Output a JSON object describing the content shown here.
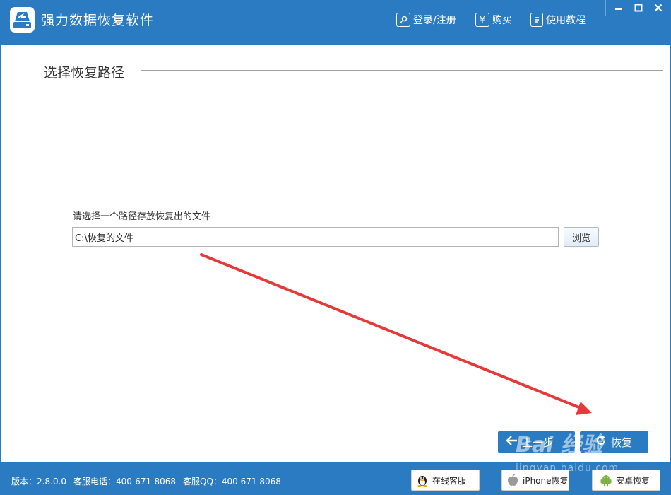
{
  "app": {
    "title": "强力数据恢复软件",
    "icon": "drive-icon"
  },
  "nav": {
    "login_label": "登录/注册",
    "buy_label": "购买",
    "buy_symbol": "¥",
    "tutorial_label": "使用教程"
  },
  "window_controls": [
    "minimize-icon",
    "maximize-icon",
    "close-icon"
  ],
  "section": {
    "title": "选择恢复路径"
  },
  "path_selector": {
    "label": "请选择一个路径存放恢复出的文件",
    "value": "C:\\恢复的文件",
    "browse_label": "浏览"
  },
  "steps": {
    "prev_label": "上一步",
    "recover_label": "恢复"
  },
  "footer": {
    "version": "版本：2.8.0.0",
    "phone": "客服电话：400-671-8068",
    "qq": "客服QQ：400 671 8068",
    "buttons": [
      {
        "label": "在线客服",
        "icon": "qq-penguin-icon"
      },
      {
        "label": "iPhone恢复",
        "icon": "apple-icon"
      },
      {
        "label": "安卓恢复",
        "icon": "android-icon"
      }
    ]
  },
  "watermark": {
    "brand": "Bai 经验",
    "url": "jingyan.baidu.com"
  },
  "colors": {
    "brand_blue": "#2a7bc2",
    "annotation_arrow": "#e63a3a"
  }
}
